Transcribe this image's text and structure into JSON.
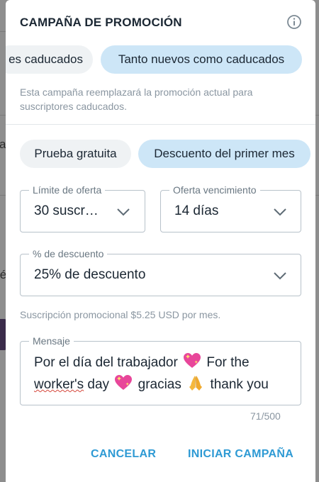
{
  "background": {
    "fragments": [
      "a",
      "fé"
    ]
  },
  "dialog": {
    "title": "CAMPAÑA DE PROMOCIÓN",
    "icons": {
      "info": "info-icon",
      "chevron": "chevron-down-icon"
    },
    "audience_options": [
      {
        "label": "Solo caducados",
        "visible_text": "es caducados",
        "selected": false
      },
      {
        "label": "Tanto nuevos como caducados",
        "selected": true
      }
    ],
    "audience_help": "Esta campaña reemplazará la promoción actual para suscriptores caducados.",
    "promo_types": [
      {
        "label": "Prueba gratuita",
        "selected": false
      },
      {
        "label": "Descuento del primer mes",
        "selected": true
      }
    ],
    "offer_limit": {
      "label": "Límite de oferta",
      "value": "30 suscr…"
    },
    "offer_expiry": {
      "label": "Oferta vencimiento",
      "value": "14 días"
    },
    "discount": {
      "label": "% de descuento",
      "value": "25% de descuento"
    },
    "price_note": "Suscripción promocional $5.25 USD por mes.",
    "message": {
      "label": "Mensaje",
      "text_part1": "Por el día del trabajador",
      "text_part2": "For the",
      "text_part3": "worker's",
      "text_part4": "day",
      "text_part5": "gracias",
      "text_part6": "thank you",
      "counter": "71/500"
    },
    "cancel_label": "CANCELAR",
    "start_label": "INICIAR CAMPAÑA"
  },
  "colors": {
    "accent": "#2e9ad4",
    "chip_selected": "#cde6f7",
    "chip_unselected": "#eff2f4",
    "scrim": "#8e8e8e"
  }
}
